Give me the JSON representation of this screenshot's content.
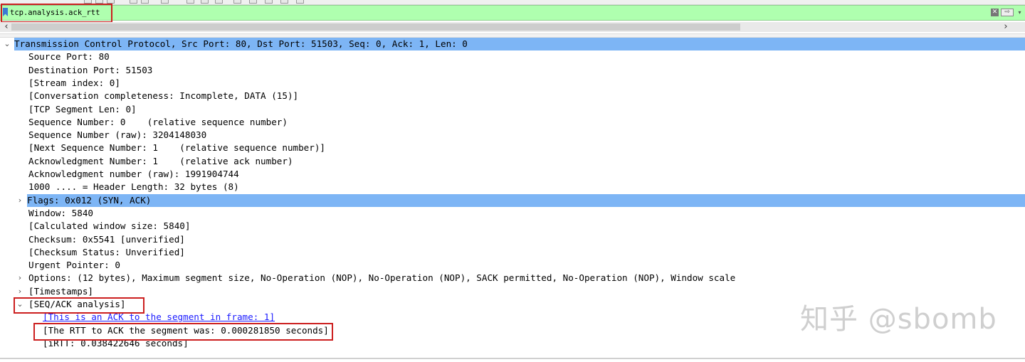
{
  "filter": {
    "value": "tcp.analysis.ack_rtt"
  },
  "icons": {
    "bookmark": "bookmark-icon",
    "clear": "✕",
    "apply": "⇨",
    "dropdown": "▾",
    "collapse": "⌄",
    "expand": "›",
    "scroll_left": "‹",
    "scroll_right": "›"
  },
  "colors": {
    "filter_valid_bg": "#afffaf",
    "selection_bg": "#7db5f5",
    "annotation_red": "#cc1f1f",
    "link_blue": "#1a1aff"
  },
  "tree": {
    "header": "Transmission Control Protocol, Src Port: 80, Dst Port: 51503, Seq: 0, Ack: 1, Len: 0",
    "source_port": "Source Port: 80",
    "destination_port": "Destination Port: 51503",
    "stream_index": "[Stream index: 0]",
    "conversation": "[Conversation completeness: Incomplete, DATA (15)]",
    "segment_len": "[TCP Segment Len: 0]",
    "seq_number": "Sequence Number: 0    (relative sequence number)",
    "seq_raw": "Sequence Number (raw): 3204148030",
    "next_seq": "[Next Sequence Number: 1    (relative sequence number)]",
    "ack_number": "Acknowledgment Number: 1    (relative ack number)",
    "ack_raw": "Acknowledgment number (raw): 1991904744",
    "header_length": "1000 .... = Header Length: 32 bytes (8)",
    "flags": "Flags: 0x012 (SYN, ACK)",
    "window": "Window: 5840",
    "calc_window": "[Calculated window size: 5840]",
    "checksum": "Checksum: 0x5541 [unverified]",
    "checksum_status": "[Checksum Status: Unverified]",
    "urgent": "Urgent Pointer: 0",
    "options": "Options: (12 bytes), Maximum segment size, No-Operation (NOP), No-Operation (NOP), SACK permitted, No-Operation (NOP), Window scale",
    "timestamps": "[Timestamps]",
    "seq_ack": "[SEQ/ACK analysis]",
    "ack_frame_link": "[This is an ACK to the segment in frame: 1]",
    "rtt": "[The RTT to ACK the segment was: 0.000281850 seconds]",
    "irtt": "[iRTT: 0.038422646 seconds]"
  },
  "watermark": "知乎 @sbomb"
}
